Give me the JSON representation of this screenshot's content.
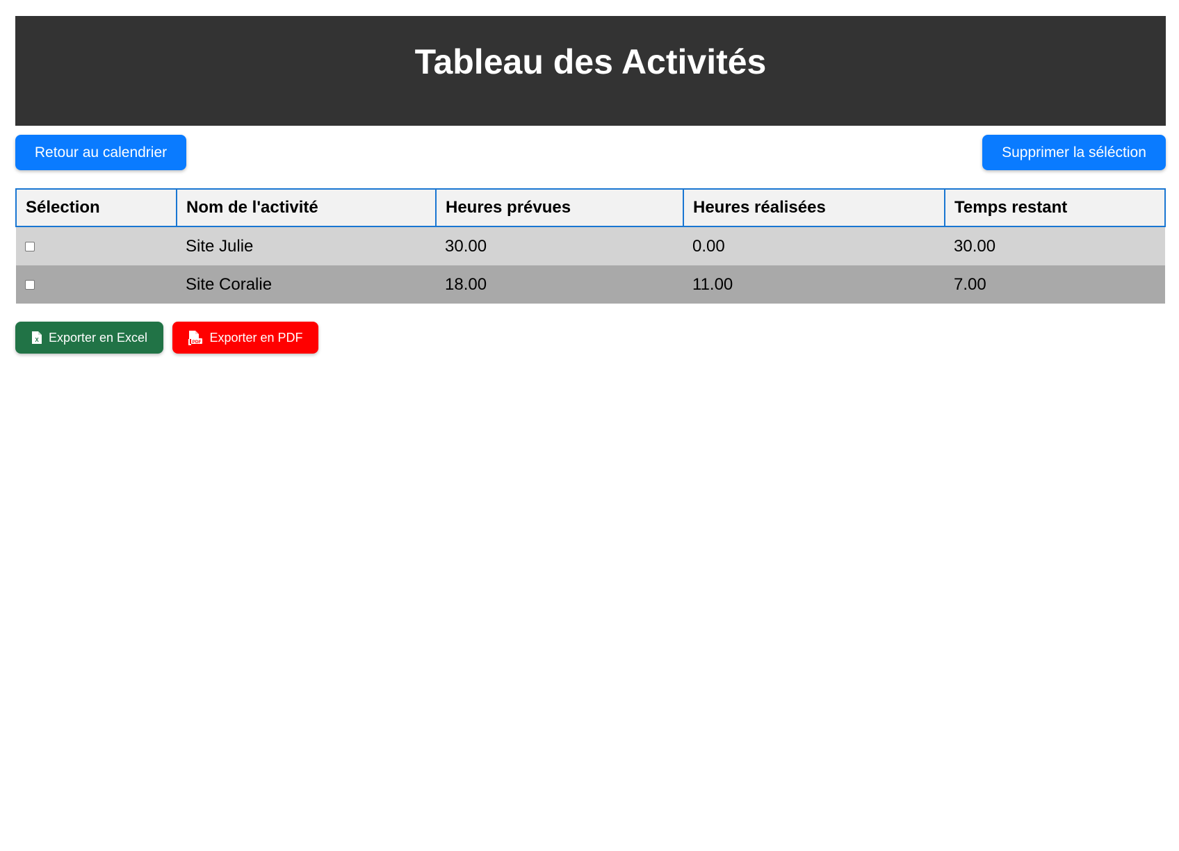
{
  "header": {
    "title": "Tableau des Activités"
  },
  "toolbar": {
    "back_label": "Retour au calendrier",
    "delete_label": "Supprimer la séléction"
  },
  "table": {
    "columns": [
      "Sélection",
      "Nom de l'activité",
      "Heures prévues",
      "Heures réalisées",
      "Temps restant"
    ],
    "rows": [
      {
        "selected": false,
        "name": "Site Julie",
        "planned": "30.00",
        "done": "0.00",
        "remaining": "30.00"
      },
      {
        "selected": false,
        "name": "Site Coralie",
        "planned": "18.00",
        "done": "11.00",
        "remaining": "7.00"
      }
    ]
  },
  "export": {
    "excel_label": "Exporter en Excel",
    "excel_icon": "file-excel-icon",
    "excel_color": "#217346",
    "pdf_label": "Exporter en PDF",
    "pdf_icon": "file-pdf-icon",
    "pdf_color": "#ff0000"
  },
  "colors": {
    "header_bg": "#333333",
    "primary_button": "#0a7bff",
    "row_light": "#d3d3d3",
    "row_dark": "#a9a9a9",
    "table_header_border": "#1976d2"
  }
}
